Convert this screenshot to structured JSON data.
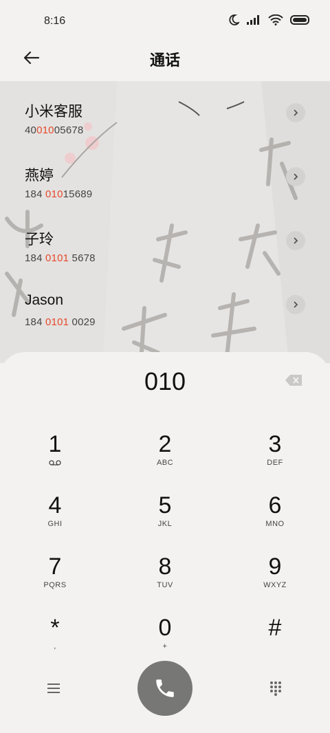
{
  "status_bar": {
    "time": "8:16"
  },
  "header": {
    "title": "通话"
  },
  "contacts": [
    {
      "name": "小米客服",
      "num_parts": [
        "40",
        "010",
        "05678"
      ]
    },
    {
      "name": "燕婷",
      "num_parts": [
        "184 ",
        "010",
        "15689"
      ]
    },
    {
      "name": "子玲",
      "num_parts": [
        "184 ",
        "0101",
        " 5678"
      ]
    },
    {
      "name": "Jason",
      "num_parts": [
        "184 ",
        "0101",
        " 0029"
      ]
    }
  ],
  "dialer": {
    "entry": "010",
    "keys": [
      {
        "digit": "1",
        "letters": ""
      },
      {
        "digit": "2",
        "letters": "ABC"
      },
      {
        "digit": "3",
        "letters": "DEF"
      },
      {
        "digit": "4",
        "letters": "GHI"
      },
      {
        "digit": "5",
        "letters": "JKL"
      },
      {
        "digit": "6",
        "letters": "MNO"
      },
      {
        "digit": "7",
        "letters": "PQRS"
      },
      {
        "digit": "8",
        "letters": "TUV"
      },
      {
        "digit": "9",
        "letters": "WXYZ"
      },
      {
        "digit": "*",
        "letters": ","
      },
      {
        "digit": "0",
        "letters": "+"
      },
      {
        "digit": "#",
        "letters": ""
      }
    ]
  },
  "colors": {
    "highlight": "#e8492c",
    "call_button": "#777775",
    "background": "#f3f2f0"
  }
}
